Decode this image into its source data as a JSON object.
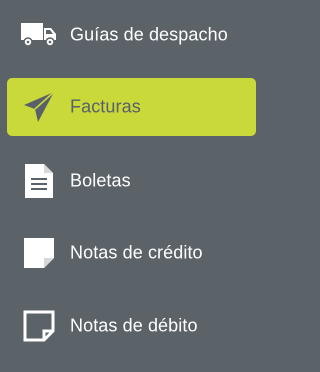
{
  "colors": {
    "background": "#5b6268",
    "active_bg": "#c9d93a",
    "active_text": "#59606a",
    "text": "#ffffff"
  },
  "menu": {
    "items": [
      {
        "label": "Guías de despacho",
        "icon": "truck-icon",
        "active": false
      },
      {
        "label": "Facturas",
        "icon": "paper-plane-icon",
        "active": true
      },
      {
        "label": "Boletas",
        "icon": "document-lines-icon",
        "active": false
      },
      {
        "label": "Notas de crédito",
        "icon": "note-filled-icon",
        "active": false
      },
      {
        "label": "Notas de débito",
        "icon": "note-outline-icon",
        "active": false
      }
    ]
  }
}
